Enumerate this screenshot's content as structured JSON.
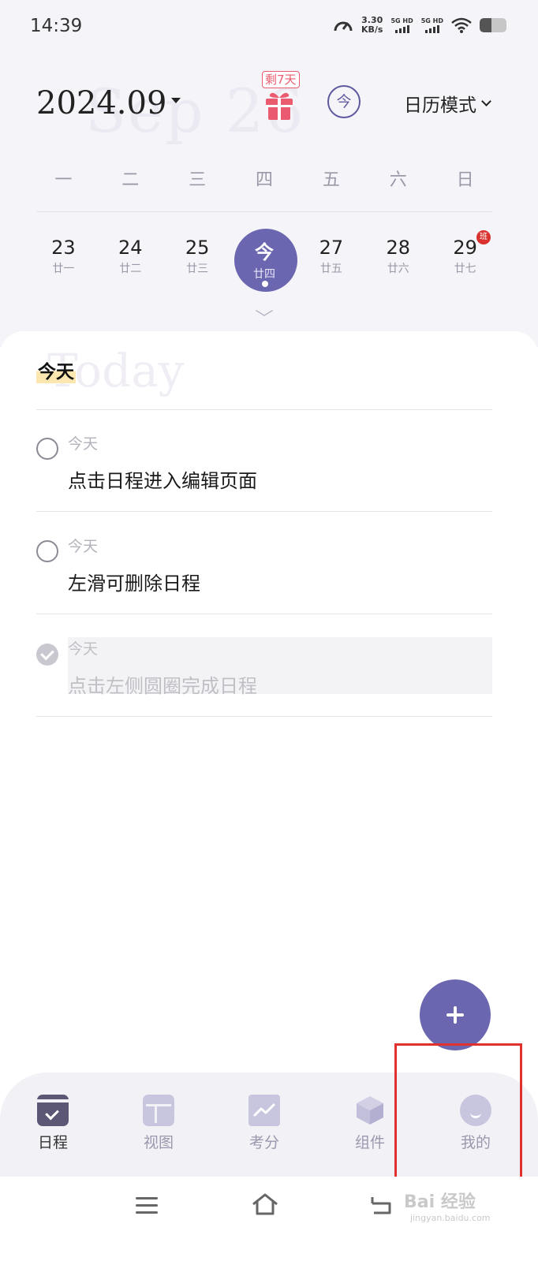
{
  "status_bar": {
    "time": "14:39",
    "net_speed_value": "3.30",
    "net_speed_unit": "KB/s",
    "sim1_label": "5G HD",
    "sim2_label": "5G HD",
    "battery_level": 0.45
  },
  "header": {
    "month": "2024.09",
    "watermark": "Sep 26",
    "gift_badge": "剩7天",
    "today_button": "今",
    "mode_label": "日历模式"
  },
  "weekdays": [
    "一",
    "二",
    "三",
    "四",
    "五",
    "六",
    "日"
  ],
  "days": [
    {
      "num": "23",
      "lunar": "廿一"
    },
    {
      "num": "24",
      "lunar": "廿二"
    },
    {
      "num": "25",
      "lunar": "廿三"
    },
    {
      "num": "今",
      "lunar": "廿四",
      "selected": true
    },
    {
      "num": "27",
      "lunar": "廿五"
    },
    {
      "num": "28",
      "lunar": "廿六"
    },
    {
      "num": "29",
      "lunar": "廿七",
      "badge": "班"
    }
  ],
  "section": {
    "title": "今天",
    "watermark": "Today"
  },
  "tasks": [
    {
      "date": "今天",
      "title": "点击日程进入编辑页面",
      "done": false
    },
    {
      "date": "今天",
      "title": "左滑可删除日程",
      "done": false
    },
    {
      "date": "今天",
      "title": "点击左侧圆圈完成日程",
      "done": true
    }
  ],
  "tabs": [
    {
      "label": "日程",
      "icon": "calendar-check-icon",
      "active": true
    },
    {
      "label": "视图",
      "icon": "layout-icon"
    },
    {
      "label": "考分",
      "icon": "chart-line-icon"
    },
    {
      "label": "组件",
      "icon": "cube-icon"
    },
    {
      "label": "我的",
      "icon": "profile-icon"
    }
  ],
  "colors": {
    "accent": "#6b66b0",
    "highlight_box": "#e0312f",
    "gift": "#ea5b6f",
    "holiday_badge": "#d9322e"
  },
  "watermark_brand": {
    "text": "Bai 经验",
    "url": "jingyan.baidu.com"
  }
}
